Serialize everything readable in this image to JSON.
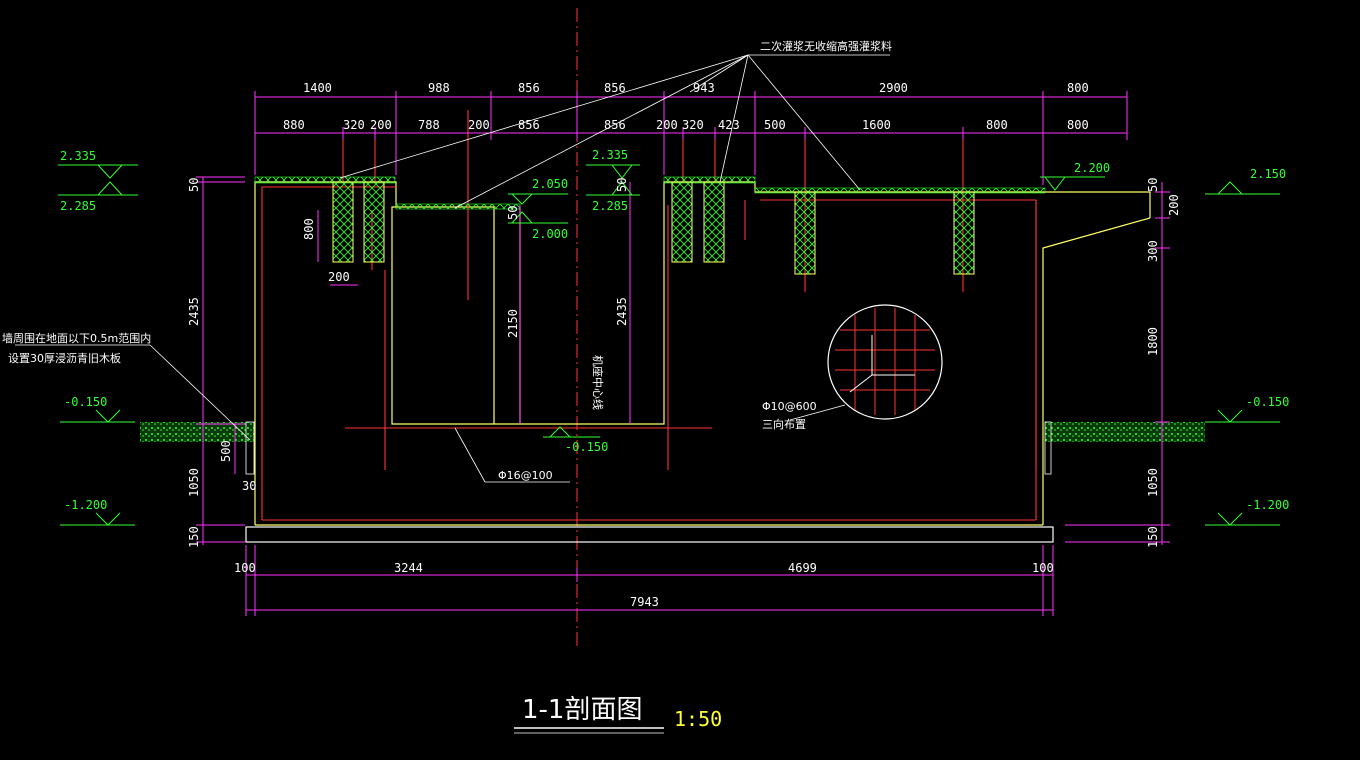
{
  "drawing": {
    "title": "1-1剖面图",
    "scale": "1:50",
    "note_top": "二次灌浆无收缩高强灌浆料",
    "note_left_line1": "墙周围在地面以下0.5m范围内",
    "note_left_line2": "设置30厚浸沥青旧木板",
    "note_center_axis": "机座中心线",
    "rebar_bottom": "Φ16@100",
    "rebar_circle_line1": "Φ10@600",
    "rebar_circle_line2": "三向布置"
  },
  "dims": {
    "top_row1": [
      "1400",
      "988",
      "856",
      "856",
      "943",
      "2900",
      "800"
    ],
    "top_row2": [
      "880",
      "320",
      "200",
      "788",
      "200",
      "856",
      "856",
      "200",
      "320",
      "423",
      "500",
      "1600",
      "800",
      "800"
    ],
    "left_vert": [
      "50",
      "800",
      "2435",
      "500",
      "1050",
      "150"
    ],
    "left_small": [
      "200",
      "30"
    ],
    "center_vert": [
      "50",
      "2150",
      "50",
      "2435"
    ],
    "right_vert": [
      "50",
      "200",
      "300",
      "1800",
      "1050",
      "150"
    ],
    "bottom_row1": [
      "100",
      "3244",
      "4699",
      "100"
    ],
    "bottom_total": "7943"
  },
  "elevations": {
    "left_top_upper": "2.335",
    "left_top_lower": "2.285",
    "mid_upper": "2.050",
    "mid_lower": "2.000",
    "center_upper": "2.335",
    "center_lower": "2.285",
    "right_slab": "2.200",
    "right_far": "2.150",
    "left_ground": "-0.150",
    "right_ground": "-0.150",
    "pit_floor": "-0.150",
    "left_base": "-1.200",
    "right_base": "-1.200"
  },
  "colors": {
    "dimension": "#ff33ff",
    "concrete": "#ffff66",
    "rebar": "#ff3333",
    "grout": "#33ff33",
    "axis": "#ff3333",
    "text": "#ffffff",
    "elevation": "#33ff33"
  }
}
